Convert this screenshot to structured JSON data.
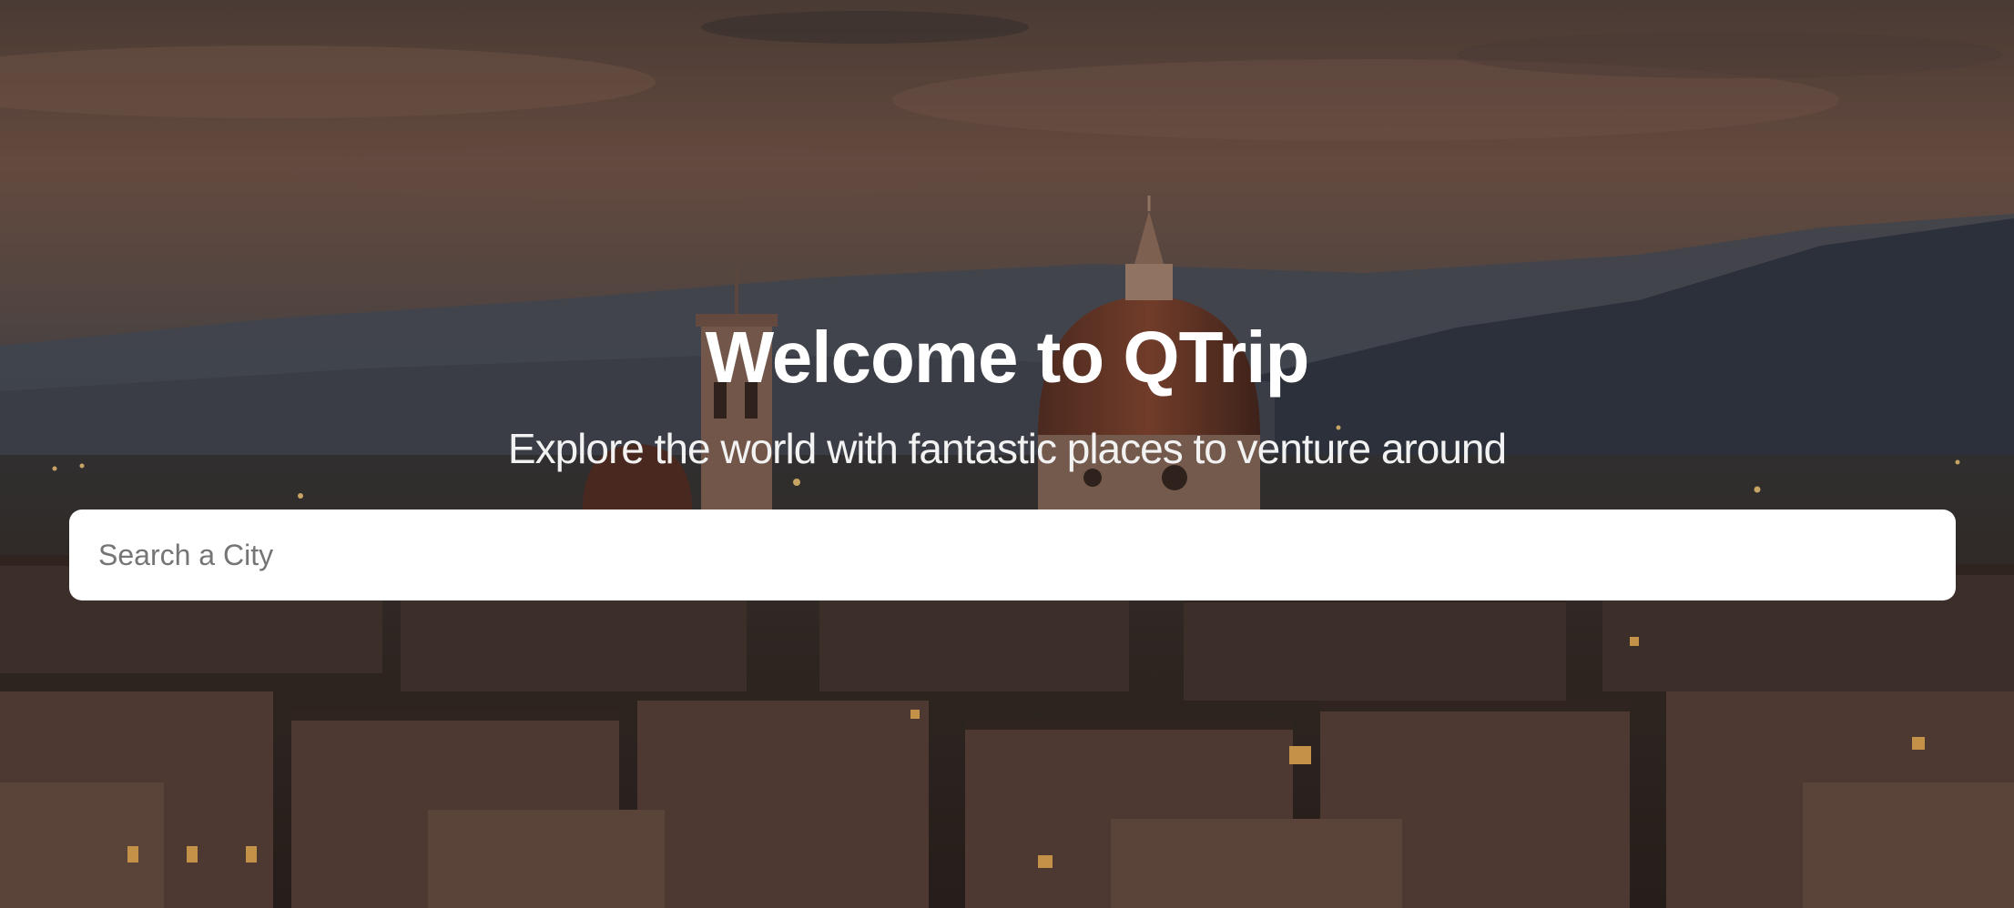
{
  "hero": {
    "title": "Welcome to QTrip",
    "subtitle": "Explore the world with fantastic places to venture around",
    "background_description_icon": "city-skyline-dusk-photo"
  },
  "search": {
    "placeholder": "Search a City",
    "value": ""
  },
  "colors": {
    "title_text": "#ffffff",
    "input_background": "#ffffff",
    "placeholder_text": "#757575"
  }
}
